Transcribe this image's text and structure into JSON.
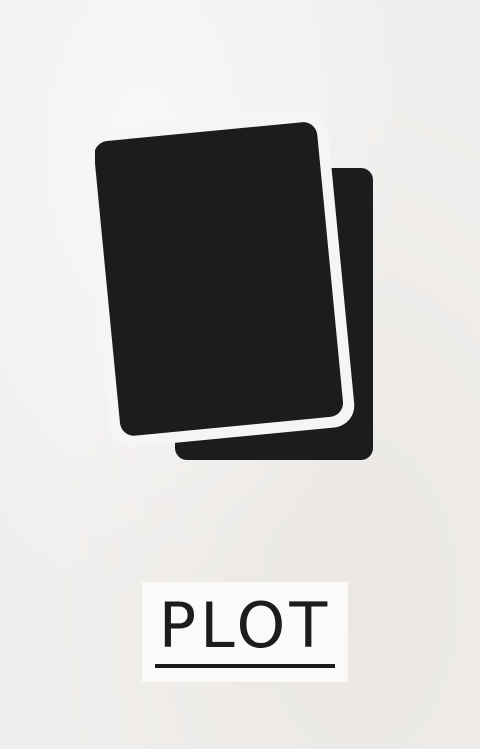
{
  "card": {
    "icon": "stacked-cards-icon",
    "label": "PLOT"
  },
  "colors": {
    "background": "#f1efed",
    "ink": "#1c1b1d",
    "outline": "#f7f5f3"
  }
}
